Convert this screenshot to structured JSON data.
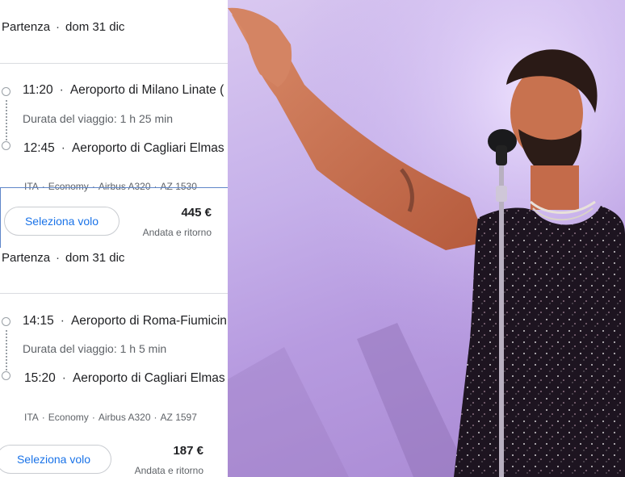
{
  "flights": [
    {
      "header": {
        "label": "Partenza",
        "date": "dom 31 dic"
      },
      "departure": {
        "time": "11:20",
        "airport": "Aeroporto di Milano Linate ("
      },
      "duration": "Durata del viaggio: 1 h 25 min",
      "arrival": {
        "time": "12:45",
        "airport": "Aeroporto di Cagliari Elmas"
      },
      "details": {
        "airline": "ITA",
        "class": "Economy",
        "aircraft": "Airbus A320",
        "flight_no": "AZ 1530"
      },
      "select_label": "Seleziona volo",
      "price": "445 €",
      "trip_type": "Andata e ritorno"
    },
    {
      "header": {
        "label": "Partenza",
        "date": "dom 31 dic"
      },
      "departure": {
        "time": "14:15",
        "airport": "Aeroporto di Roma-Fiumicin"
      },
      "duration": "Durata del viaggio: 1 h 5 min",
      "arrival": {
        "time": "15:20",
        "airport": "Aeroporto di Cagliari Elmas"
      },
      "details": {
        "airline": "ITA",
        "class": "Economy",
        "aircraft": "Airbus A320",
        "flight_no": "AZ 1597"
      },
      "select_label": "Seleziona volo",
      "price": "187 €",
      "trip_type": "Andata e ritorno"
    }
  ],
  "separator": "·",
  "colors": {
    "link_blue": "#1a73e8",
    "secondary_text": "#5f6368",
    "stage_purple": "#b79be0",
    "skin": "#c8724f"
  }
}
